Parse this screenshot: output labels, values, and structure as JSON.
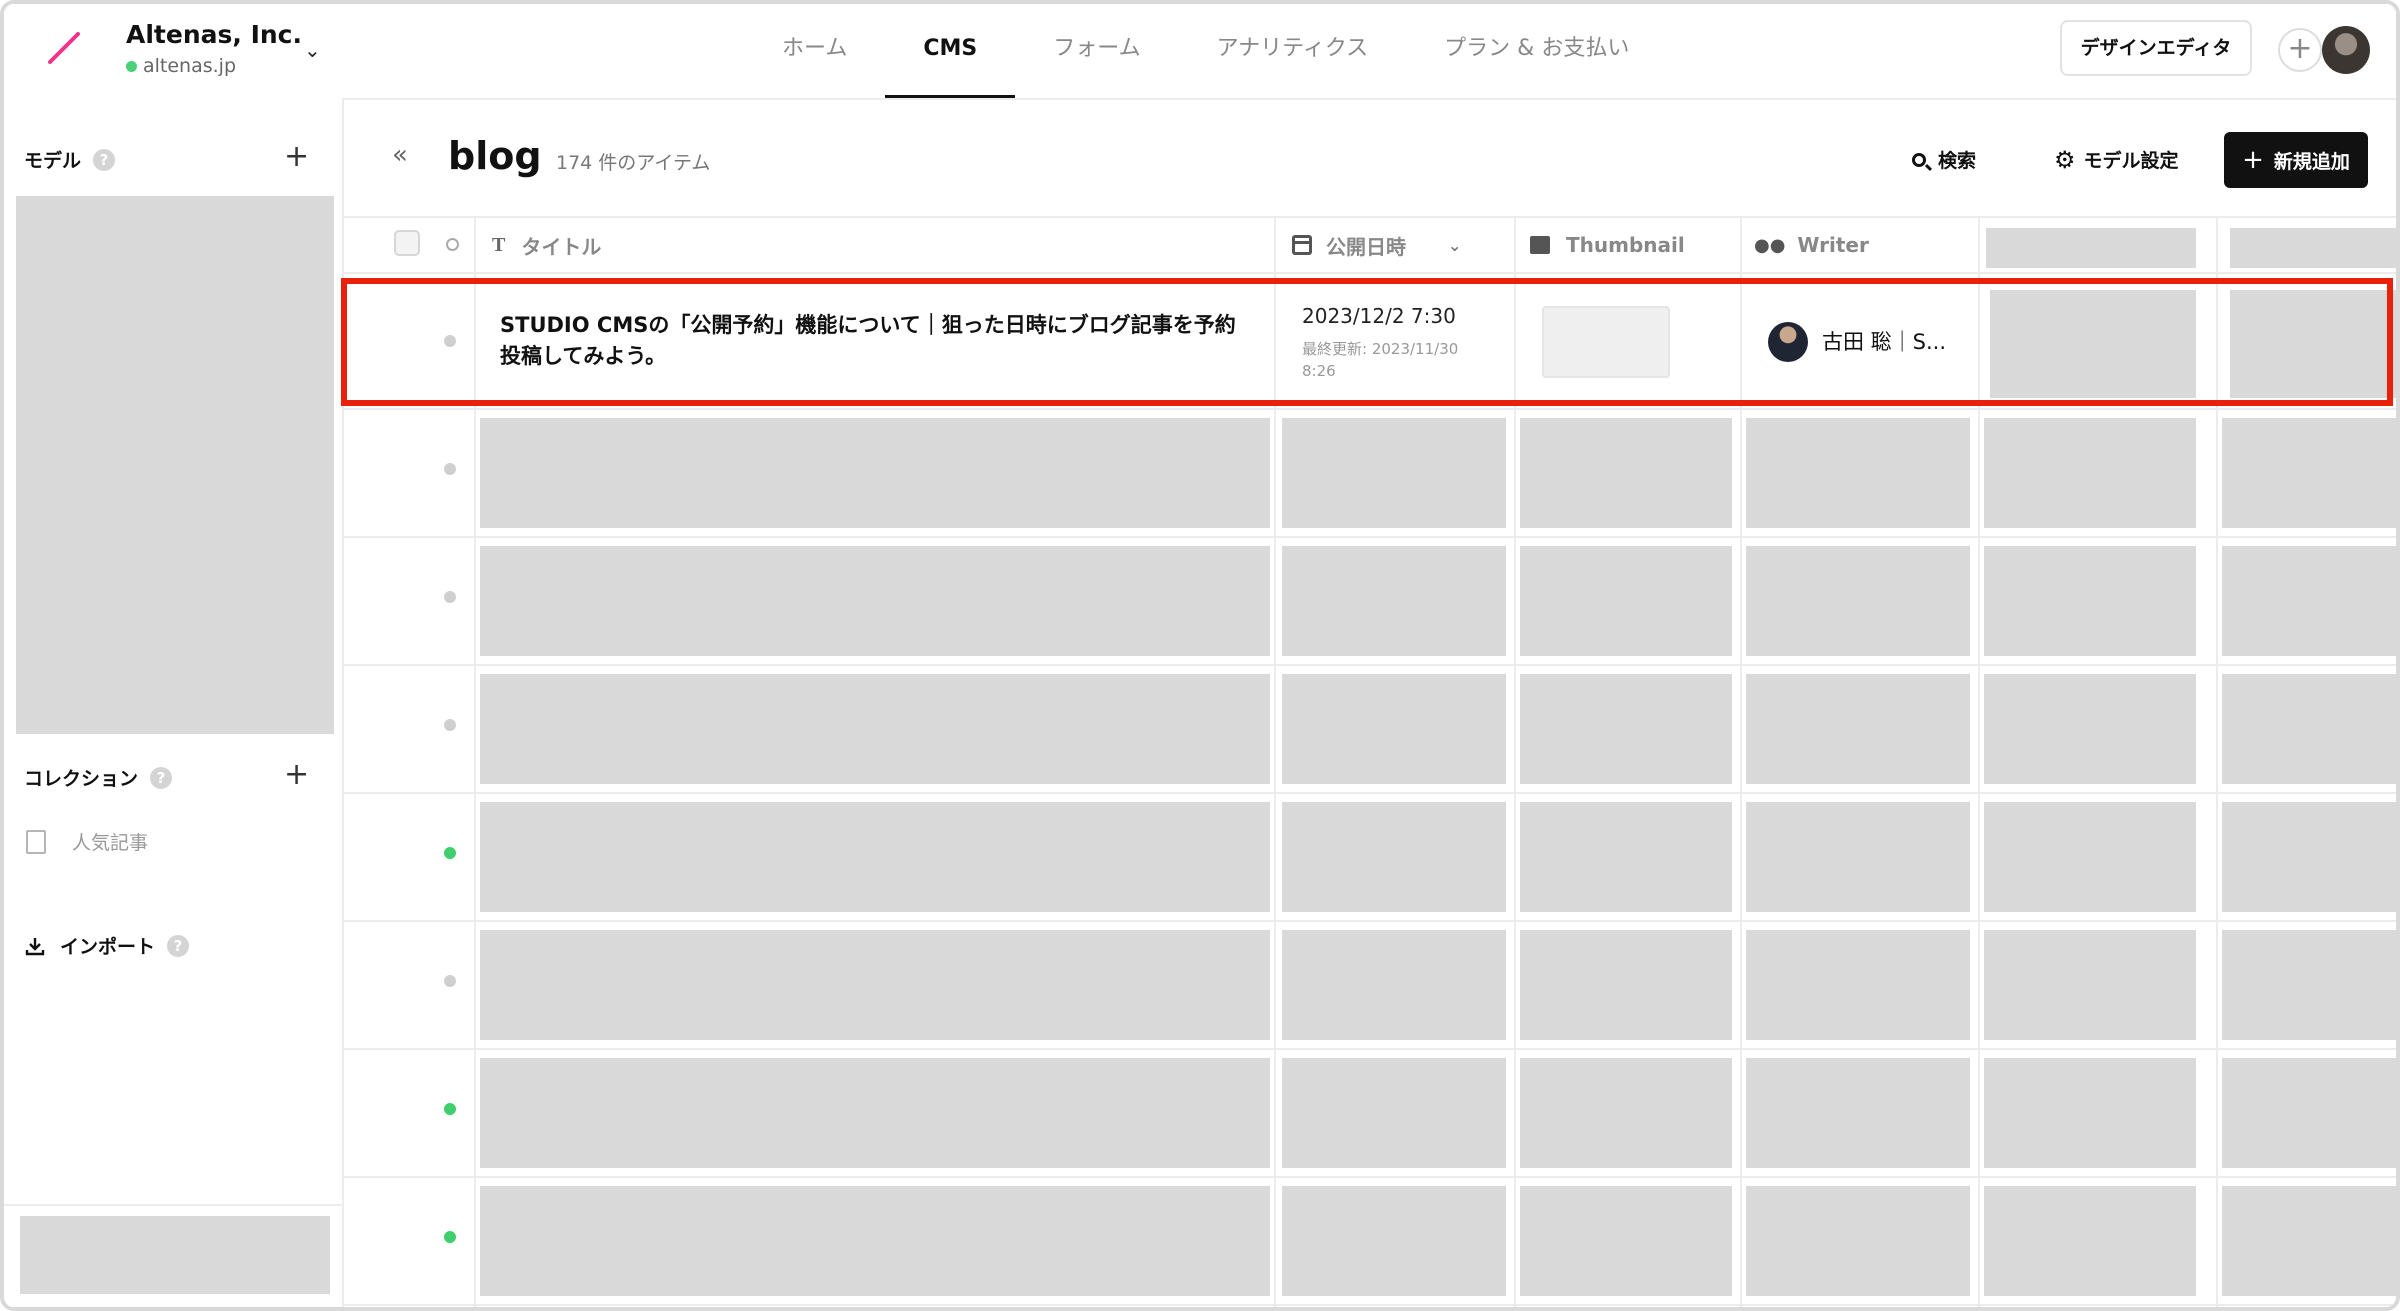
{
  "org": {
    "name": "Altenas, Inc.",
    "url": "altenas.jp"
  },
  "nav": {
    "items": [
      "ホーム",
      "CMS",
      "フォーム",
      "アナリティクス",
      "プラン & お支払い"
    ],
    "active": "CMS"
  },
  "header": {
    "design_editor": "デザインエディタ"
  },
  "sidebar": {
    "model_label": "モデル",
    "collection_label": "コレクション",
    "collection_items": [
      "人気記事"
    ],
    "import_label": "インポート",
    "help_glyph": "?"
  },
  "main": {
    "title": "blog",
    "item_count": "174 件のアイテム",
    "search_label": "検索",
    "model_settings_label": "モデル設定",
    "add_new_label": "新規追加"
  },
  "table": {
    "columns": [
      "タイトル",
      "公開日時",
      "Thumbnail",
      "Writer"
    ],
    "rows": [
      {
        "title": "STUDIO CMSの「公開予約」機能について｜狙った日時にブログ記事を予約投稿してみよう。",
        "date": "2023/12/2 7:30",
        "updated": "最終更新: 2023/11/30 8:26",
        "writer": "古田 聡｜S..."
      }
    ],
    "row_status": [
      "gray",
      "gray",
      "gray",
      "gray",
      "green",
      "gray",
      "green",
      "green"
    ]
  },
  "colors": {
    "accent_highlight": "#e8210d",
    "status_published": "#3ecf6c",
    "status_draft": "#cfcfcf",
    "logo": "#f0338a"
  },
  "icons": [
    "logo-slash-icon",
    "chevron-down-icon",
    "plus-icon",
    "help-icon",
    "document-icon",
    "download-icon",
    "collapse-left-icon",
    "search-icon",
    "gear-icon",
    "text-type-icon",
    "calendar-icon",
    "image-icon",
    "people-icon"
  ]
}
